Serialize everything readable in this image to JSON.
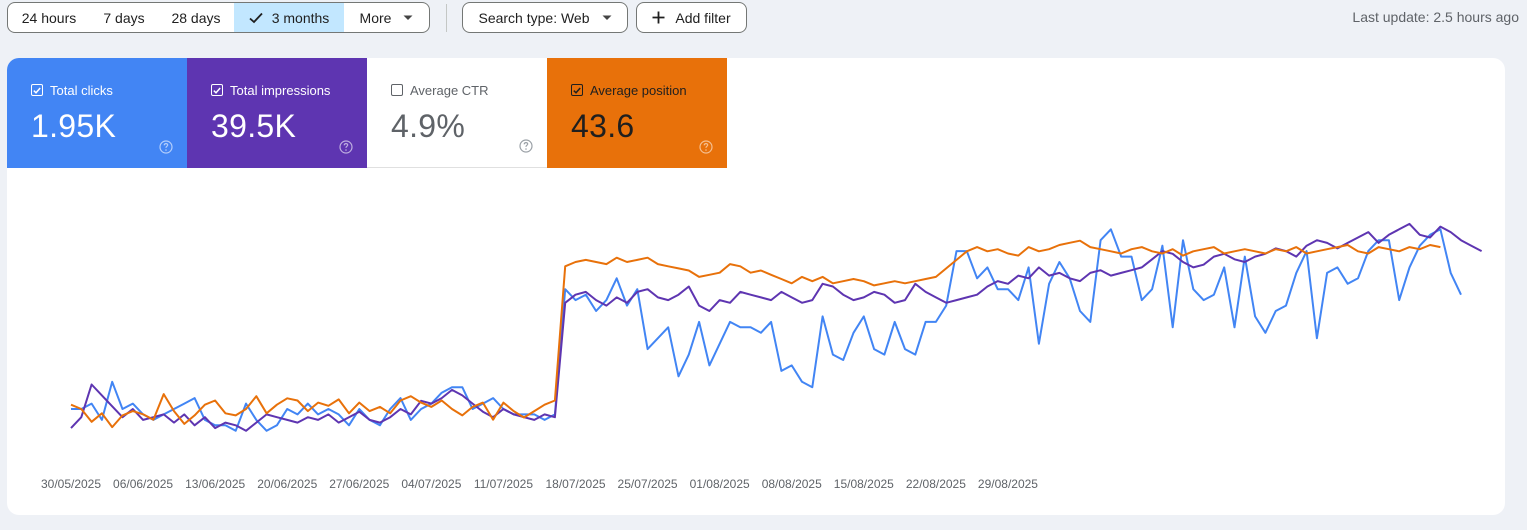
{
  "toolbar": {
    "range_24h": "24 hours",
    "range_7d": "7 days",
    "range_28d": "28 days",
    "range_3m": "3 months",
    "more": "More",
    "search_type": "Search type: Web",
    "add_filter": "Add filter",
    "last_update": "Last update: 2.5 hours ago"
  },
  "metrics": {
    "clicks": {
      "label": "Total clicks",
      "value": "1.95K",
      "checked": true,
      "color": "#4285f4"
    },
    "impressions": {
      "label": "Total impressions",
      "value": "39.5K",
      "checked": true,
      "color": "#5e35b1"
    },
    "ctr": {
      "label": "Average CTR",
      "value": "4.9%",
      "checked": false,
      "color": "#ffffff"
    },
    "position": {
      "label": "Average position",
      "value": "43.6",
      "checked": true,
      "color": "#e8710a"
    }
  },
  "chart_data": {
    "type": "line",
    "start_date": "2025-05-30",
    "x_tick_labels": [
      "30/05/2025",
      "06/06/2025",
      "13/06/2025",
      "20/06/2025",
      "27/06/2025",
      "04/07/2025",
      "11/07/2025",
      "18/07/2025",
      "25/07/2025",
      "01/08/2025",
      "08/08/2025",
      "15/08/2025",
      "22/08/2025",
      "29/08/2025"
    ],
    "y_scale": "independent per series, no axis labels shown",
    "grid": false,
    "series": [
      {
        "name": "Total clicks",
        "color": "#4285f4",
        "values": [
          9,
          9,
          10,
          7,
          14,
          9,
          10,
          8,
          7,
          8,
          9,
          10,
          11,
          7,
          6,
          6,
          5,
          10,
          7,
          5,
          6,
          9,
          8,
          10,
          8,
          9,
          8,
          6,
          9,
          7,
          6,
          9,
          11,
          7,
          9,
          10,
          12,
          13,
          13,
          9,
          10,
          11,
          9,
          8,
          8,
          8,
          7,
          8,
          31,
          29,
          30,
          27,
          29,
          33,
          28,
          31,
          20,
          22,
          24,
          15,
          19,
          25,
          17,
          21,
          25,
          24,
          24,
          23,
          25,
          16,
          17,
          14,
          13,
          26,
          19,
          18,
          23,
          26,
          20,
          19,
          25,
          20,
          19,
          25,
          25,
          28,
          38,
          38,
          33,
          35,
          31,
          31,
          29,
          35,
          21,
          32,
          36,
          33,
          27,
          25,
          40,
          42,
          37,
          37,
          29,
          31,
          39,
          24,
          40,
          31,
          29,
          30,
          35,
          24,
          37,
          26,
          23,
          27,
          28,
          34,
          38,
          22,
          34,
          35,
          32,
          33,
          38,
          40,
          40,
          29,
          35,
          39,
          41,
          42,
          34,
          30
        ]
      },
      {
        "name": "Total impressions",
        "color": "#5e35b1",
        "values": [
          760,
          800,
          920,
          880,
          840,
          800,
          830,
          790,
          800,
          810,
          780,
          810,
          770,
          800,
          760,
          780,
          770,
          750,
          780,
          810,
          800,
          790,
          780,
          800,
          790,
          810,
          780,
          800,
          820,
          790,
          780,
          800,
          830,
          810,
          860,
          850,
          870,
          900,
          880,
          850,
          820,
          800,
          830,
          810,
          800,
          790,
          810,
          800,
          1220,
          1250,
          1260,
          1230,
          1210,
          1240,
          1220,
          1260,
          1270,
          1240,
          1230,
          1250,
          1280,
          1210,
          1190,
          1230,
          1220,
          1260,
          1250,
          1240,
          1230,
          1260,
          1240,
          1220,
          1230,
          1290,
          1280,
          1250,
          1230,
          1240,
          1260,
          1250,
          1220,
          1230,
          1290,
          1260,
          1240,
          1220,
          1230,
          1240,
          1250,
          1280,
          1300,
          1290,
          1320,
          1310,
          1350,
          1320,
          1330,
          1310,
          1300,
          1330,
          1340,
          1320,
          1330,
          1340,
          1350,
          1380,
          1410,
          1400,
          1370,
          1350,
          1360,
          1390,
          1400,
          1380,
          1370,
          1390,
          1400,
          1420,
          1410,
          1390,
          1430,
          1450,
          1440,
          1420,
          1440,
          1460,
          1480,
          1440,
          1470,
          1490,
          1510,
          1470,
          1460,
          1500,
          1480,
          1450,
          1430,
          1410
        ]
      },
      {
        "name": "Average position",
        "color": "#e8710a",
        "values": [
          45.0,
          45.4,
          46.6,
          45.8,
          47.1,
          46.0,
          45.6,
          45.9,
          46.4,
          44.0,
          45.6,
          46.8,
          46.0,
          45.0,
          44.6,
          45.8,
          46.0,
          45.4,
          44.2,
          45.8,
          45.0,
          44.4,
          44.6,
          45.6,
          44.8,
          45.1,
          44.5,
          45.8,
          44.8,
          45.6,
          45.2,
          45.8,
          44.6,
          44.2,
          44.8,
          45.2,
          44.6,
          45.4,
          46.0,
          45.2,
          44.8,
          46.4,
          44.8,
          45.6,
          46.2,
          45.6,
          45.0,
          44.6,
          32.0,
          31.6,
          31.4,
          31.6,
          31.8,
          31.2,
          31.6,
          31.4,
          31.2,
          31.8,
          32.0,
          32.2,
          32.4,
          33.0,
          32.8,
          32.6,
          31.8,
          32.0,
          32.6,
          32.4,
          32.8,
          33.2,
          33.6,
          33.0,
          33.4,
          33.0,
          33.6,
          33.4,
          33.2,
          33.4,
          33.8,
          33.6,
          33.4,
          33.6,
          33.4,
          33.2,
          33.0,
          32.2,
          31.4,
          30.6,
          30.2,
          30.6,
          30.4,
          30.8,
          31.0,
          30.2,
          30.6,
          30.4,
          30.0,
          29.8,
          29.6,
          30.2,
          30.4,
          30.6,
          30.8,
          30.4,
          30.2,
          30.6,
          30.8,
          30.4,
          31.0,
          30.6,
          30.4,
          30.2,
          30.8,
          30.6,
          30.4,
          30.6,
          30.8,
          30.4,
          30.6,
          30.2,
          30.8,
          30.6,
          30.4,
          30.2,
          30.0,
          30.6,
          30.8,
          30.2,
          30.4,
          30.6,
          30.2,
          30.4,
          30.0,
          30.2
        ]
      }
    ]
  }
}
